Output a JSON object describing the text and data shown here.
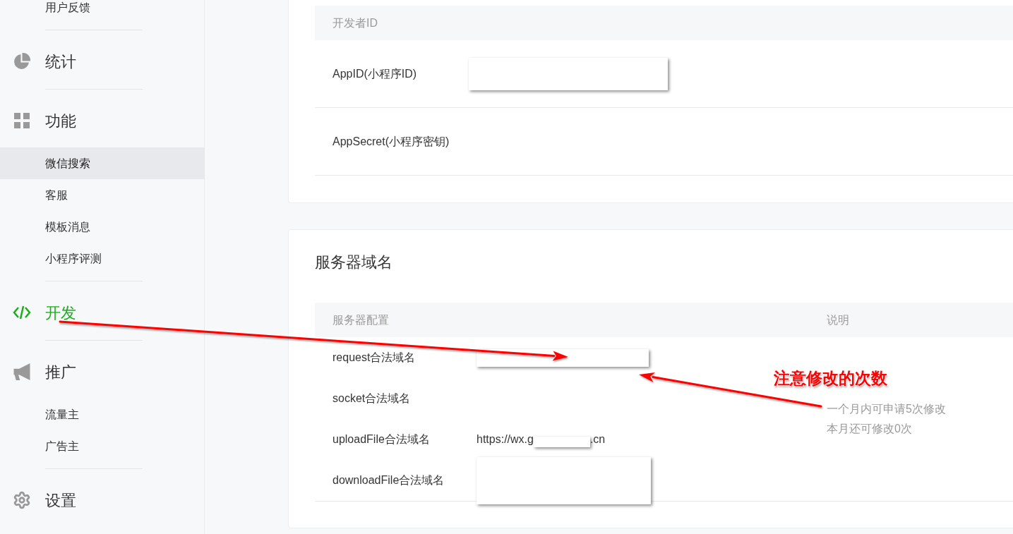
{
  "sidebar": {
    "groups": [
      {
        "items": [
          {
            "label": "用户反馈",
            "selected": false
          }
        ]
      },
      {
        "label": "统计",
        "kind": "stats",
        "selected": false
      },
      {
        "label": "功能",
        "kind": "features",
        "selected": false,
        "items": [
          {
            "label": "微信搜索",
            "selected": true
          },
          {
            "label": "客服",
            "selected": false
          },
          {
            "label": "模板消息",
            "selected": false
          },
          {
            "label": "小程序评测",
            "selected": false
          }
        ]
      },
      {
        "label": "开发",
        "kind": "develop",
        "selected": true
      },
      {
        "label": "推广",
        "kind": "promote",
        "selected": false,
        "items": [
          {
            "label": "流量主",
            "selected": false
          },
          {
            "label": "广告主",
            "selected": false
          }
        ]
      },
      {
        "label": "设置",
        "kind": "settings",
        "selected": false
      }
    ]
  },
  "developer_id": {
    "table": {
      "columns": [
        "开发者ID"
      ],
      "rows": [
        {
          "label": "AppID(小程序ID)",
          "redacted": true
        },
        {
          "label": "AppSecret(小程序密钥)",
          "redacted": false
        }
      ]
    }
  },
  "server_domains": {
    "title": "服务器域名",
    "table": {
      "columns": [
        "服务器配置",
        "说明"
      ],
      "rows": [
        {
          "label": "request合法域名",
          "redacted": true
        },
        {
          "label": "socket合法域名",
          "redacted": false
        },
        {
          "label": "uploadFile合法域名",
          "value": "https://wx.g",
          "value_end": ".cn",
          "redacted": true
        },
        {
          "label": "downloadFile合法域名",
          "redacted": true
        }
      ],
      "note": [
        "一个月内可申请5次修改",
        "本月还可修改0次"
      ]
    }
  },
  "annotation": {
    "text": "注意修改的次数"
  }
}
